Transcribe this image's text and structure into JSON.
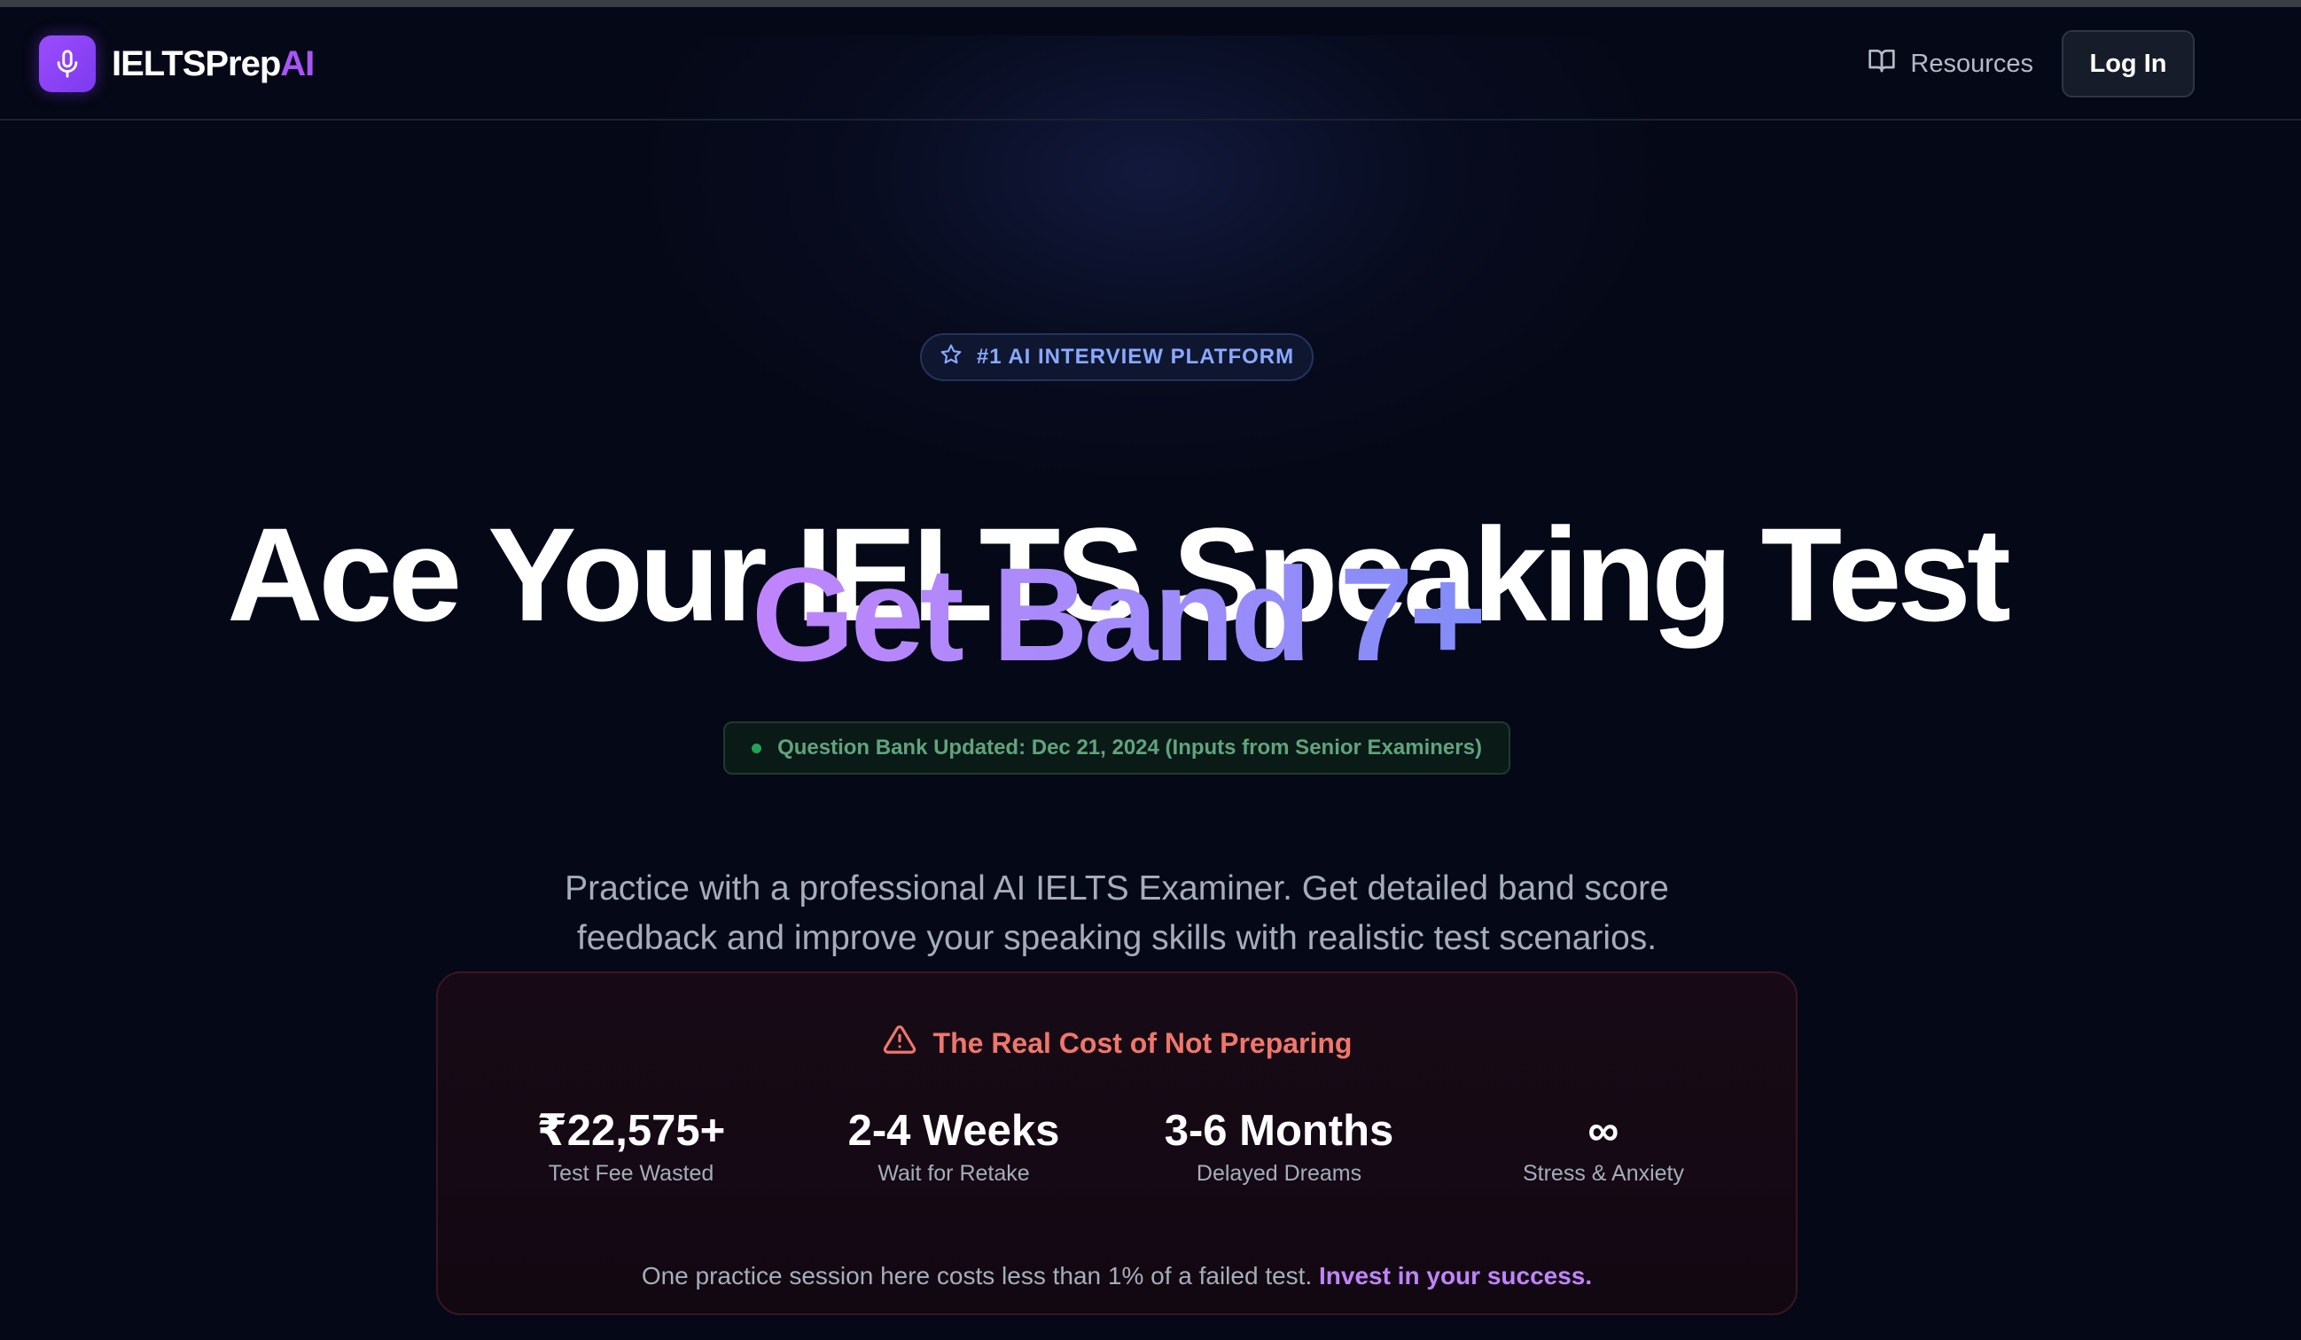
{
  "nav": {
    "logo_text": "IELTSPrep",
    "logo_accent": "AI",
    "resources_label": "Resources",
    "login_label": "Log In"
  },
  "hero": {
    "badge": "#1 AI INTERVIEW PLATFORM",
    "headline_line1": "Ace Your IELTS Speaking Test",
    "headline_line2": "Get Band 7+",
    "update_notice": "Question Bank Updated: Dec 21, 2024 (Inputs from Senior Examiners)",
    "description": "Practice with a professional AI IELTS Examiner. Get detailed band score feedback and improve your speaking skills with realistic test scenarios."
  },
  "cost": {
    "title": "The Real Cost of Not Preparing",
    "stats": [
      {
        "value": "₹22,575+",
        "label": "Test Fee Wasted"
      },
      {
        "value": "2-4 Weeks",
        "label": "Wait for Retake"
      },
      {
        "value": "3-6 Months",
        "label": "Delayed Dreams"
      },
      {
        "value": "∞",
        "label": "Stress & Anxiety"
      }
    ],
    "footer_text": "One practice session here costs less than 1% of a failed test.",
    "footer_cta": "Invest in your success."
  },
  "colors": {
    "background": "#050816",
    "accent_purple": "#a855f7",
    "warning_red": "#f0766b",
    "success_green": "#22a35a",
    "badge_blue": "#8aa9ff"
  },
  "icons": {
    "logo": "microphone-icon",
    "resources": "book-open-icon",
    "badge": "star-icon",
    "cost_title": "warning-triangle-icon"
  }
}
